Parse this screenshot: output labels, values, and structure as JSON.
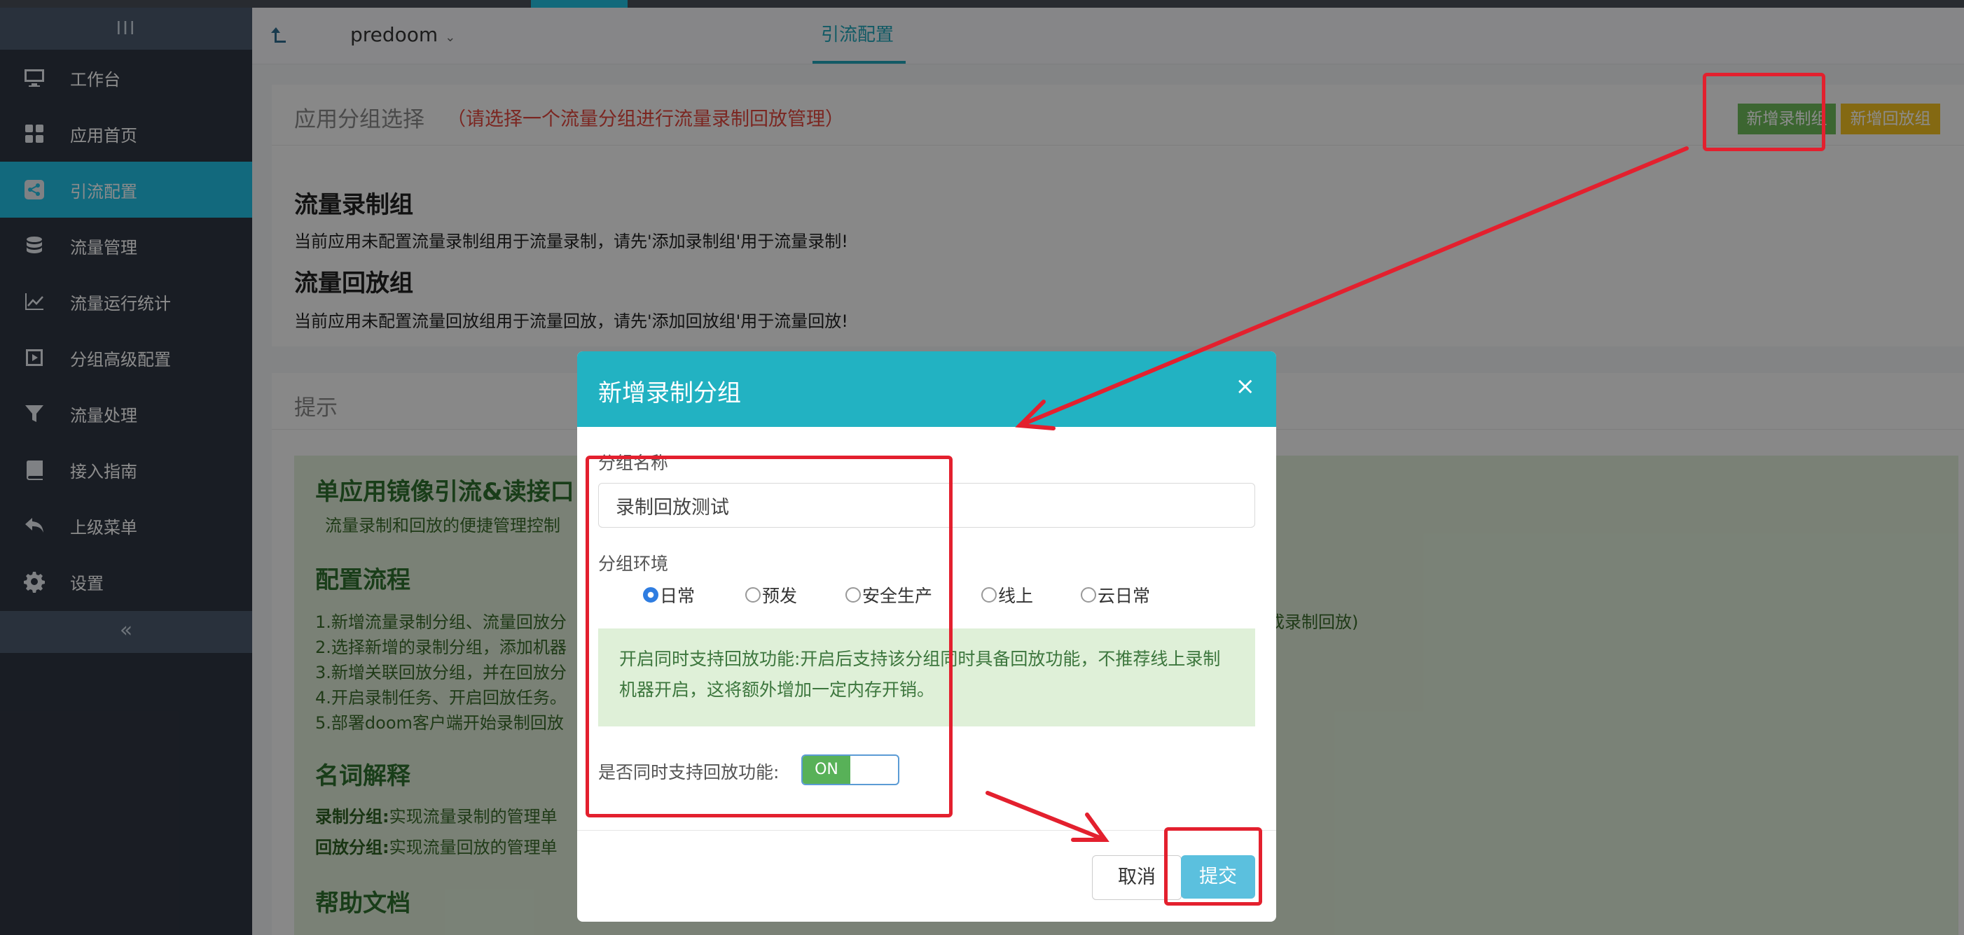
{
  "sidebar": {
    "toggle_glyph": "III",
    "items": [
      {
        "label": "工作台",
        "icon": "monitor-icon"
      },
      {
        "label": "应用首页",
        "icon": "grid-icon"
      },
      {
        "label": "引流配置",
        "icon": "share-icon",
        "active": true
      },
      {
        "label": "流量管理",
        "icon": "database-icon"
      },
      {
        "label": "流量运行统计",
        "icon": "line-chart-icon"
      },
      {
        "label": "分组高级配置",
        "icon": "play-square-icon"
      },
      {
        "label": "流量处理",
        "icon": "filter-icon"
      },
      {
        "label": "接入指南",
        "icon": "book-icon"
      },
      {
        "label": "上级菜单",
        "icon": "reply-icon"
      },
      {
        "label": "设置",
        "icon": "gear-icon"
      }
    ],
    "collapse_glyph": "«"
  },
  "navbar": {
    "app_name": "predoom",
    "chevron": "⌄",
    "tab": "引流配置"
  },
  "group_panel": {
    "title": "应用分组选择",
    "hint": "（请选择一个流量分组进行流量录制回放管理）",
    "add_record_button": "新增录制组",
    "add_replay_button": "新增回放组",
    "record_title": "流量录制组",
    "record_desc": "当前应用未配置流量录制组用于流量录制，请先'添加录制组'用于流量录制!",
    "replay_title": "流量回放组",
    "replay_desc": "当前应用未配置流量回放组用于流量回放，请先'添加回放组'用于流量回放!"
  },
  "tips_panel": {
    "title": "提示",
    "heading": "单应用镜像引流&读接口",
    "subtitle": "流量录制和回放的便捷管理控制",
    "flow_title": "配置流程",
    "steps": [
      "1.新增流量录制分组、流量回放分",
      "2.选择新增的录制分组，添加机器",
      "3.新增关联回放分组，并在回放分",
      "4.开启录制任务、开启回放任务。",
      "5.部署doom客户端开始录制回放"
    ],
    "step1_tail": "成录制回放)",
    "terms_title": "名词解释",
    "term1_key": "录制分组:",
    "term1_val": "实现流量录制的管理单",
    "term2_key": "回放分组:",
    "term2_val": "实现流量回放的管理单",
    "help_title": "帮助文档"
  },
  "modal": {
    "title": "新增录制分组",
    "close": "×",
    "name_label": "分组名称",
    "name_value": "录制回放测试",
    "env_label": "分组环境",
    "env_options": [
      "日常",
      "预发",
      "安全生产",
      "线上",
      "云日常"
    ],
    "env_selected": "日常",
    "note": "开启同时支持回放功能:开启后支持该分组同时具备回放功能，不推荐线上录制机器开启，这将额外增加一定内存开销。",
    "replay_support_label": "是否同时支持回放功能:",
    "toggle_state": "ON",
    "cancel_button": "取消",
    "submit_button": "提交"
  },
  "colors": {
    "sidebar_bg": "#2f3542",
    "sidebar_active": "#22c0e3",
    "modal_header": "#22b2c2",
    "record_button": "#6dbb5a",
    "replay_button": "#f0c021",
    "submit_button": "#5bc0de",
    "annotation": "#e3202e"
  }
}
